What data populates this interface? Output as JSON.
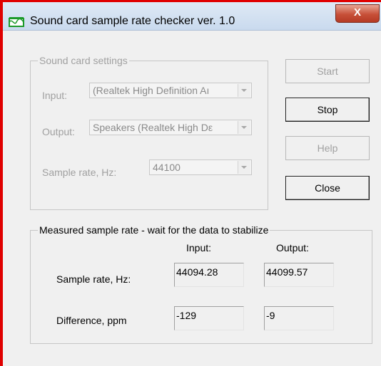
{
  "window": {
    "title": "Sound card sample rate checker ver. 1.0",
    "close_label": "X"
  },
  "settings": {
    "group_title": "Sound card settings",
    "input_label": "Input:",
    "input_value": "(Realtek High Definition Aı",
    "output_label": "Output:",
    "output_value": "Speakers (Realtek High Dε",
    "rate_label": "Sample rate, Hz:",
    "rate_value": "44100"
  },
  "buttons": {
    "start": "Start",
    "stop": "Stop",
    "help": "Help",
    "close": "Close"
  },
  "measured": {
    "group_title": "Measured sample rate - wait for the data to stabilize",
    "col_input": "Input:",
    "col_output": "Output:",
    "rate_label": "Sample rate, Hz:",
    "rate_input": "44094.28",
    "rate_output": "44099.57",
    "diff_label": "Difference, ppm",
    "diff_input": "-129",
    "diff_output": "-9"
  },
  "colors": {
    "highlight_border": "#e00000",
    "titlebar": "#dfe9f5",
    "close_button": "#c75039"
  }
}
